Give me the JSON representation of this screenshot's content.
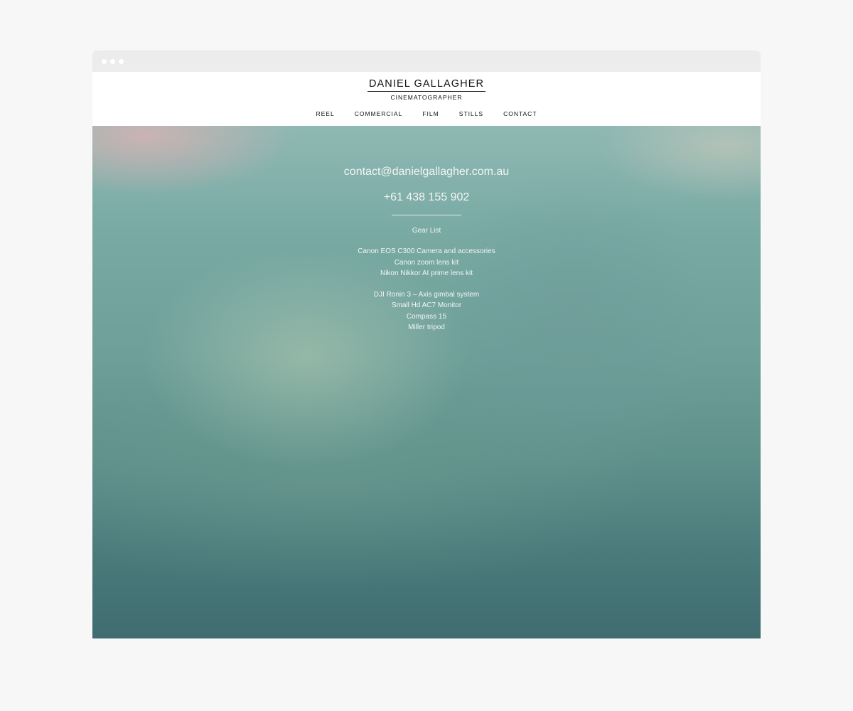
{
  "brand": {
    "name": "DANIEL GALLAGHER",
    "subtitle": "CINEMATOGRAPHER"
  },
  "nav": [
    "REEL",
    "COMMERCIAL",
    "FILM",
    "STILLS",
    "CONTACT"
  ],
  "contact": {
    "email": "contact@danielgallagher.com.au",
    "phone": "+61 438 155 902"
  },
  "gear": {
    "title": "Gear List",
    "groups": [
      [
        "Canon EOS C300 Camera and accessories",
        "Canon zoom lens kit",
        "Nikon Nikkor AI prime lens kit"
      ],
      [
        "DJI Ronin 3 – Axis gimbal system",
        "Small Hd AC7 Monitor",
        "Compass 15",
        "Miller tripod"
      ]
    ]
  }
}
